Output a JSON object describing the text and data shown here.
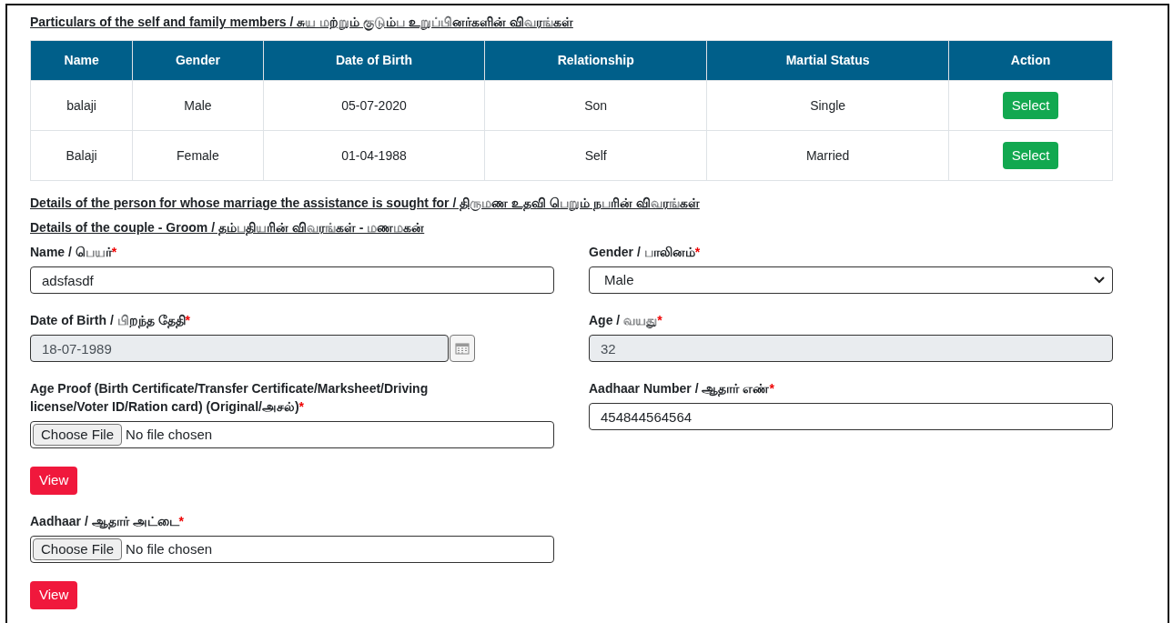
{
  "family_section": {
    "title": "Particulars of the self and family members / சுய மற்றும் குடும்ப உறுப்பினர்களின் விவரங்கள்",
    "table": {
      "columns": [
        "Name",
        "Gender",
        "Date of Birth",
        "Relationship",
        "Martial Status",
        "Action"
      ],
      "rows": [
        {
          "cells": [
            "balaji",
            "Male",
            "05-07-2020",
            "Son",
            "Single"
          ],
          "action": "Select"
        },
        {
          "cells": [
            "Balaji",
            "Female",
            "01-04-1988",
            "Self",
            "Married"
          ],
          "action": "Select"
        }
      ]
    }
  },
  "headings": [
    "Details of the person for whose marriage the assistance is sought for / திருமண உதவி பெறும் நபரின் விவரங்கள்",
    "Details of the couple - Groom / தம்பதியரின் விவரங்கள் - மணமகன்"
  ],
  "fields": [
    {
      "kind": "text",
      "label": "Name / பெயர்",
      "required_mark": "*",
      "value": "adsfasdf"
    },
    {
      "kind": "select",
      "label": "Gender / பாலினம்",
      "required_mark": "*",
      "value": "Male"
    },
    {
      "kind": "date",
      "label": "Date of Birth / பிறந்த தேதி",
      "required_mark": "*",
      "value": "18-07-1989"
    },
    {
      "kind": "readonly",
      "label": "Age / வயது",
      "required_mark": "*",
      "value": "32"
    },
    {
      "kind": "file",
      "label": "Age Proof (Birth Certificate/Transfer Certificate/Marksheet/Driving license/Voter ID/Ration card) (Original/அசல்)",
      "required_mark": "*",
      "button": "Choose File",
      "status": "No file chosen",
      "view_button": "View"
    },
    {
      "kind": "text",
      "label": "Aadhaar Number / ஆதார் எண்",
      "required_mark": "*",
      "value": "454844564564"
    },
    {
      "kind": "file",
      "label": "Aadhaar / ஆதார் அட்டை",
      "required_mark": "*",
      "button": "Choose File",
      "status": "No file chosen",
      "view_button": "View"
    }
  ]
}
